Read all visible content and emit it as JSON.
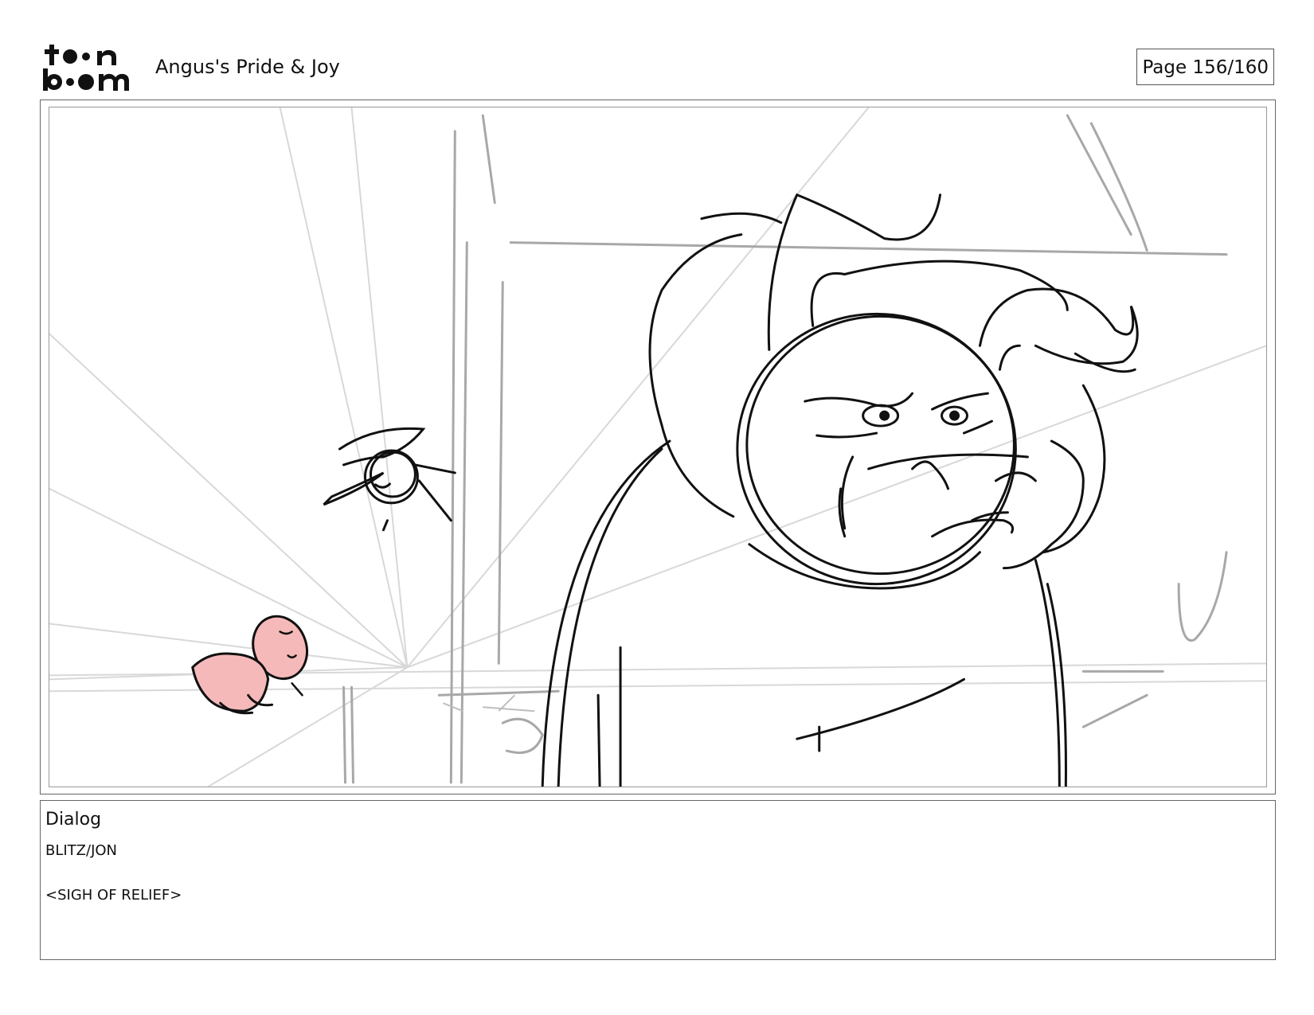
{
  "header": {
    "logo_text_top": "toon",
    "logo_text_bottom": "boom",
    "project_title": "Angus's Pride & Joy",
    "page_label": "Page 156/160"
  },
  "panel": {
    "illustration": "storyboard-sketch"
  },
  "dialog": {
    "heading": "Dialog",
    "speaker": "BLITZ/JON",
    "line": "<SIGH OF RELIEF>"
  },
  "colors": {
    "sketch_line": "#111111",
    "guide_line": "#bdbdbd",
    "highlight_fill": "#f6b9b9"
  }
}
